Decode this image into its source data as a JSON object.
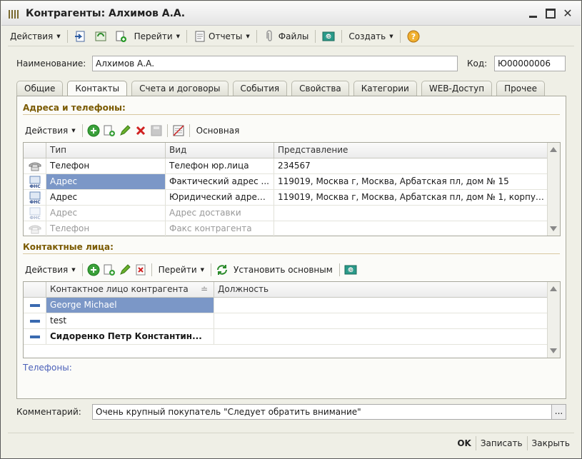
{
  "window": {
    "title": "Контрагенты: Алхимов А.А."
  },
  "toolbar": {
    "actions_label": "Действия",
    "goto_label": "Перейти",
    "reports_label": "Отчеты",
    "files_label": "Файлы",
    "create_label": "Создать"
  },
  "form": {
    "name_label": "Наименование:",
    "name_value": "Алхимов А.А.",
    "code_label": "Код:",
    "code_value": "Ю00000006"
  },
  "tabs": [
    {
      "label": "Общие"
    },
    {
      "label": "Контакты"
    },
    {
      "label": "Счета и договоры"
    },
    {
      "label": "События"
    },
    {
      "label": "Свойства"
    },
    {
      "label": "Категории"
    },
    {
      "label": "WEB-Доступ"
    },
    {
      "label": "Прочее"
    }
  ],
  "addresses": {
    "title": "Адреса и телефоны:",
    "actions_label": "Действия",
    "main_label": "Основная",
    "headers": [
      "Тип",
      "Вид",
      "Представление"
    ],
    "rows": [
      {
        "type": "Телефон",
        "kind": "Телефон юр.лица",
        "value": "234567",
        "icon": "phone-icon"
      },
      {
        "type": "Адрес",
        "kind": "Фактический адрес ...",
        "value": "119019, Москва г, Москва, Арбатская пл, дом № 15",
        "icon": "fns-address-icon"
      },
      {
        "type": "Адрес",
        "kind": "Юридический адрес ...",
        "value": "119019, Москва г, Москва, Арбатская пл, дом № 1, корпус...",
        "icon": "fns-address-icon"
      },
      {
        "type": "Адрес",
        "kind": "Адрес доставки",
        "value": "",
        "icon": "fns-address-icon"
      },
      {
        "type": "Телефон",
        "kind": "Факс контрагента",
        "value": "",
        "icon": "phone-icon"
      }
    ]
  },
  "contacts": {
    "title": "Контактные лица:",
    "actions_label": "Действия",
    "goto_label": "Перейти",
    "set_main_label": "Установить основным",
    "headers": [
      "Контактное лицо контрагента",
      "Должность"
    ],
    "rows": [
      {
        "name": "George Michael",
        "position": ""
      },
      {
        "name": "test",
        "position": ""
      },
      {
        "name": "Сидоренко Петр Константин...",
        "position": ""
      }
    ],
    "phones_link": "Телефоны:"
  },
  "comment": {
    "label": "Комментарий:",
    "value": "Очень крупный покупатель \"Следует обратить внимание\"",
    "button": "..."
  },
  "bottom": {
    "ok": "OK",
    "save": "Записать",
    "close": "Закрыть"
  }
}
